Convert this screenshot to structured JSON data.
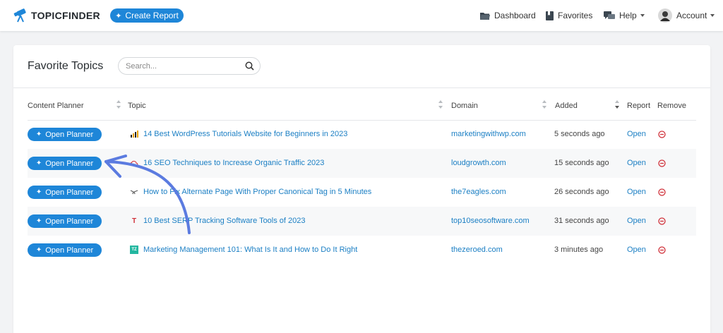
{
  "brand": {
    "name": "TOPICFINDER"
  },
  "header": {
    "create_label": "Create Report",
    "nav": {
      "dashboard": "Dashboard",
      "favorites": "Favorites",
      "help": "Help",
      "account": "Account"
    }
  },
  "page": {
    "title": "Favorite Topics",
    "search_placeholder": "Search..."
  },
  "table": {
    "columns": {
      "planner": "Content Planner",
      "topic": "Topic",
      "domain": "Domain",
      "added": "Added",
      "report": "Report",
      "remove": "Remove"
    },
    "planner_label": "Open Planner",
    "report_label": "Open",
    "rows": [
      {
        "favicon": "chart-favicon",
        "topic": "14 Best WordPress Tutorials Website for Beginners in 2023",
        "domain": "marketingwithwp.com",
        "added": "5 seconds ago"
      },
      {
        "favicon": "cloud-favicon",
        "topic": "16 SEO Techniques to Increase Organic Traffic 2023",
        "domain": "loudgrowth.com",
        "added": "15 seconds ago"
      },
      {
        "favicon": "eagle-favicon",
        "topic": "How to Fix Alternate Page With Proper Canonical Tag in 5 Minutes",
        "domain": "the7eagles.com",
        "added": "26 seconds ago"
      },
      {
        "favicon": "t-favicon",
        "favicon_text": "T",
        "topic": "10 Best SERP Tracking Software Tools of 2023",
        "domain": "top10seosoftware.com",
        "added": "31 seconds ago"
      },
      {
        "favicon": "zeroed-favicon",
        "favicon_text": "TZ",
        "topic": "Marketing Management 101: What Is It and How to Do It Right",
        "domain": "thezeroed.com",
        "added": "3 minutes ago"
      }
    ]
  },
  "colors": {
    "accent": "#1e86d8",
    "link": "#1b7fc4",
    "remove": "#d0313a",
    "annotation_arrow": "#5b7be0"
  }
}
